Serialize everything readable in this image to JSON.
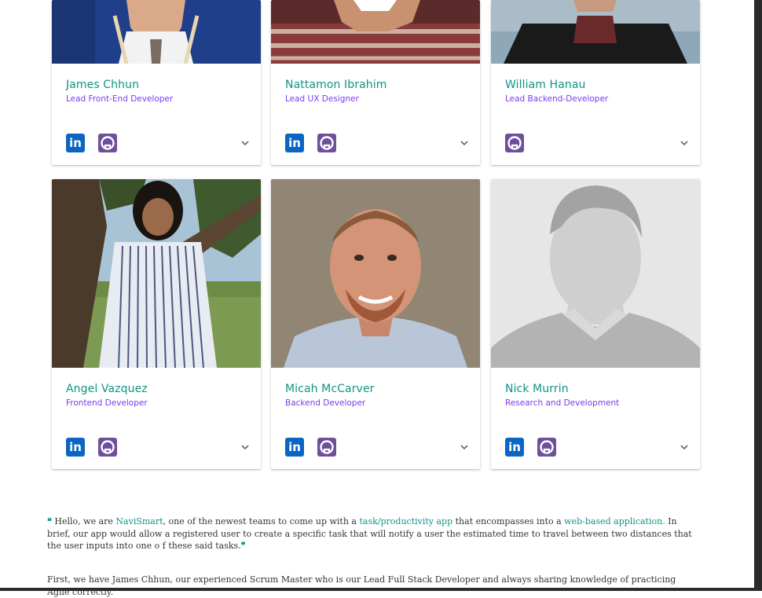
{
  "team": [
    {
      "name": "James Chhun",
      "role": "Lead Front-End Developer",
      "linkedin": true,
      "github": true
    },
    {
      "name": "Nattamon Ibrahim",
      "role": "Lead UX Designer",
      "linkedin": true,
      "github": true
    },
    {
      "name": "William Hanau",
      "role": "Lead Backend-Developer",
      "linkedin": false,
      "github": true
    },
    {
      "name": "Angel Vazquez",
      "role": "Frontend Developer",
      "linkedin": true,
      "github": true
    },
    {
      "name": "Micah McCarver",
      "role": "Backend Developer",
      "linkedin": true,
      "github": true
    },
    {
      "name": "Nick Murrin",
      "role": "Research and Development",
      "linkedin": true,
      "github": true
    }
  ],
  "icons": {
    "linkedin": "linkedin-icon",
    "github": "github-icon",
    "expand": "chevron-down-icon",
    "quote_open": "quote-open-icon",
    "quote_close": "quote-close-icon"
  },
  "icon_glyphs": {
    "linkedin": "in",
    "quote_open": "❝",
    "quote_close": "❞"
  },
  "about": {
    "p1_a": "Hello, we are ",
    "p1_brand": "NaviSmart",
    "p1_b": ", one of the newest teams to come up with a ",
    "p1_link1": "task/productivity app",
    "p1_c": "  that encompasses into a ",
    "p1_link2": "web-based application.",
    "p1_d": "  In brief, our app would allow a registered user to create a specific task that will notify a user the estimated time to travel between two distances that the user inputs into one o f these said tasks.",
    "p2": "First, we have James Chhun, our experienced Scrum Master who is our Lead Full Stack Developer and always sharing knowledge of practicing Agile correctly."
  },
  "colors": {
    "name": "#0d9488",
    "role": "#7c3aed",
    "linkedin": "#0a66c2",
    "github": "#6e4f9c",
    "link": "#0d9488"
  }
}
